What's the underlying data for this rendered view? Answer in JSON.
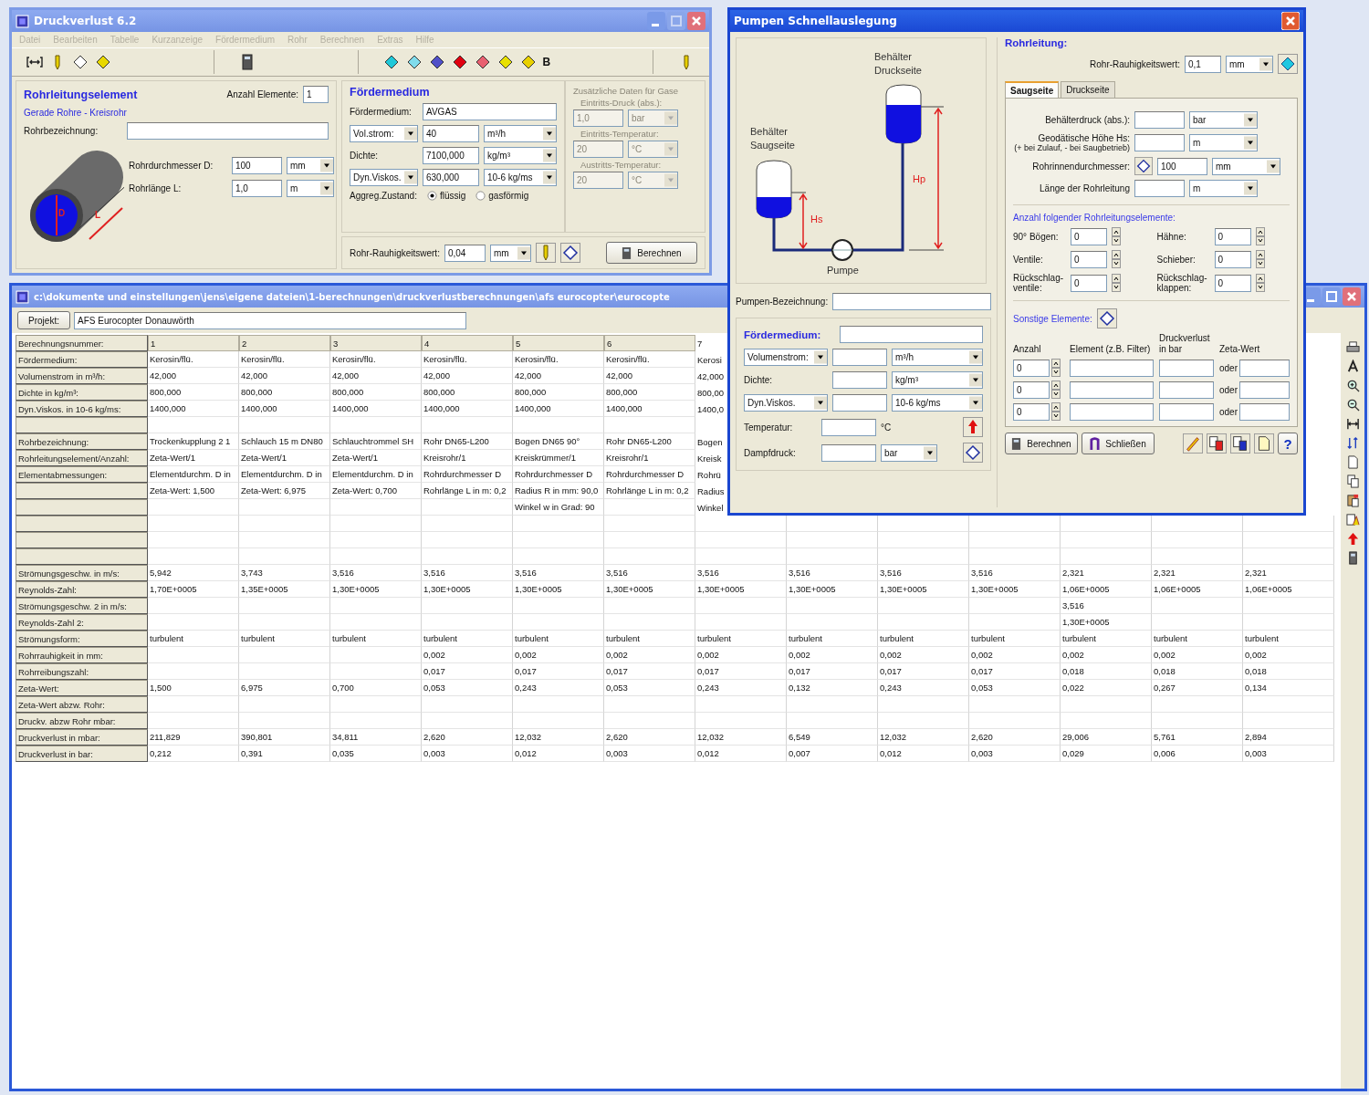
{
  "main_window": {
    "title": "Druckverlust 6.2",
    "menu": [
      {
        "label": "Datei",
        "disabled": true
      },
      {
        "label": "Bearbeiten",
        "disabled": true
      },
      {
        "label": "Tabelle",
        "disabled": true
      },
      {
        "label": "Kurzanzeige",
        "disabled": true
      },
      {
        "label": "Fördermedium",
        "disabled": true
      },
      {
        "label": "Rohr",
        "disabled": true
      },
      {
        "label": "Berechnen",
        "disabled": true
      },
      {
        "label": "Extras",
        "disabled": true
      },
      {
        "label": "Hilfe",
        "disabled": true
      }
    ],
    "toolbar": [
      {
        "kind": "bracket"
      },
      {
        "kind": "pencil"
      },
      {
        "kind": "diamond",
        "color": "#ffffff"
      },
      {
        "kind": "diamond",
        "color": "#e8d800"
      },
      {
        "kind": "separator"
      },
      {
        "kind": "calculator"
      },
      {
        "kind": "separator"
      },
      {
        "kind": "diamond",
        "color": "#20c8d8"
      },
      {
        "kind": "diamond",
        "color": "#80dcec"
      },
      {
        "kind": "diamond",
        "color": "#5050c8"
      },
      {
        "kind": "diamond",
        "color": "#e00010"
      },
      {
        "kind": "diamond",
        "color": "#e86070"
      },
      {
        "kind": "diamond",
        "color": "#e8e000"
      },
      {
        "kind": "diamond",
        "color": "#e8d000"
      },
      {
        "kind": "text",
        "label": "B"
      },
      {
        "kind": "separator"
      },
      {
        "kind": "pencil"
      }
    ],
    "pipe_element": {
      "heading": "Rohrleitungselement",
      "count_label": "Anzahl Elemente:",
      "count": "1",
      "type": "Gerade Rohre - Kreisrohr",
      "name_label": "Rohrbezeichnung:",
      "drawing_labels": [
        "D",
        "L"
      ],
      "fields": [
        {
          "label": "Rohrdurchmesser D:",
          "value": "100",
          "unit": "mm"
        },
        {
          "label": "Rohrlänge L:",
          "value": "1,0",
          "unit": "m"
        }
      ]
    },
    "medium": {
      "heading": "Fördermedium",
      "medium_label": "Fördermedium:",
      "medium": "AVGAS",
      "rows": [
        {
          "kind": "select",
          "label": "Vol.strom:",
          "value": "40",
          "unit": "m³/h"
        },
        {
          "kind": "label",
          "label": "Dichte:",
          "value": "7100,000",
          "unit": "kg/m³"
        },
        {
          "kind": "select",
          "label": "Dyn.Viskos.",
          "value": "630,000",
          "unit": "10-6 kg/ms"
        }
      ],
      "state_label": "Aggreg.Zustand:",
      "states": [
        {
          "label": "flüssig",
          "selected": true
        },
        {
          "label": "gasförmig",
          "selected": false
        }
      ]
    },
    "gas": {
      "heading": "Zusätzliche Daten für Gase",
      "disabled": true,
      "rows": [
        {
          "label": "Eintritts-Druck (abs.):",
          "value": "1,0",
          "unit": "bar"
        },
        {
          "label": "Eintritts-Temperatur:",
          "value": "20",
          "unit": "°C"
        },
        {
          "label": "Austritts-Temperatur:",
          "value": "20",
          "unit": "°C"
        }
      ]
    },
    "roughness": {
      "label": "Rohr-Rauhigkeitswert:",
      "value": "0,04",
      "unit": "mm"
    },
    "calculate_button": "Berechnen"
  },
  "table_window": {
    "title": "c:\\dokumente und einstellungen\\jens\\eigene dateien\\1-berechnungen\\druckverlustberechnungen\\afs eurocopter\\eurocopte",
    "project_button": "Projekt:",
    "project": "AFS Eurocopter Donauwörth",
    "rows": [
      {
        "kind": "header",
        "label": "Berechnungsnummer:",
        "cells": [
          "1",
          "2",
          "3",
          "4",
          "5",
          "6",
          "7"
        ]
      },
      {
        "kind": "data",
        "label": "Fördermedium:",
        "cells": [
          "Kerosin/flü.",
          "Kerosin/flü.",
          "Kerosin/flü.",
          "Kerosin/flü.",
          "Kerosin/flü.",
          "Kerosin/flü.",
          "Kerosi"
        ]
      },
      {
        "kind": "data",
        "label": "Volumenstrom in m³/h:",
        "cells": [
          "42,000",
          "42,000",
          "42,000",
          "42,000",
          "42,000",
          "42,000",
          "42,000"
        ]
      },
      {
        "kind": "data",
        "label": "Dichte in kg/m³:",
        "cells": [
          "800,000",
          "800,000",
          "800,000",
          "800,000",
          "800,000",
          "800,000",
          "800,00"
        ]
      },
      {
        "kind": "data",
        "label": "Dyn.Viskos. in 10-6 kg/ms:",
        "cells": [
          "1400,000",
          "1400,000",
          "1400,000",
          "1400,000",
          "1400,000",
          "1400,000",
          "1400,0"
        ]
      },
      {
        "kind": "data",
        "cells": []
      },
      {
        "kind": "data",
        "label": "Rohrbezeichnung:",
        "cells": [
          "Trockenkupplung 2 1",
          "Schlauch 15 m DN80",
          "Schlauchtrommel SH",
          "Rohr DN65-L200",
          "Bogen DN65 90°",
          "Rohr DN65-L200",
          "Bogen"
        ]
      },
      {
        "kind": "data",
        "label": "Rohrleitungselement/Anzahl:",
        "cells": [
          "Zeta-Wert/1",
          "Zeta-Wert/1",
          "Zeta-Wert/1",
          "Kreisrohr/1",
          "Kreiskrümmer/1",
          "Kreisrohr/1",
          "Kreisk"
        ]
      },
      {
        "kind": "data",
        "label": "Elementabmessungen:",
        "cells": [
          "Elementdurchm. D in",
          "Elementdurchm. D in",
          "Elementdurchm. D in",
          "Rohrdurchmesser D",
          "Rohrdurchmesser D",
          "Rohrdurchmesser D",
          "Rohrü"
        ]
      },
      {
        "kind": "data",
        "cells": [
          "Zeta-Wert: 1,500",
          "Zeta-Wert: 6,975",
          "Zeta-Wert: 0,700",
          "Rohrlänge L in m: 0,2",
          "Radius R in mm: 90,0",
          "Rohrlänge L in m: 0,2",
          "Radius"
        ]
      },
      {
        "kind": "data",
        "cells": [
          "",
          "",
          "",
          "",
          "Winkel w in Grad: 90",
          "",
          "Winkel"
        ]
      },
      {
        "kind": "data",
        "cells": []
      },
      {
        "kind": "data",
        "cells": []
      },
      {
        "kind": "data",
        "cells": []
      },
      {
        "kind": "data",
        "label": "Strömungsgeschw. in m/s:",
        "cells": [
          "5,942",
          "3,743",
          "3,516",
          "3,516",
          "3,516",
          "3,516",
          "3,516",
          "3,516",
          "3,516",
          "3,516",
          "2,321",
          "2,321",
          "2,321"
        ]
      },
      {
        "kind": "data",
        "label": "Reynolds-Zahl:",
        "cells": [
          "1,70E+0005",
          "1,35E+0005",
          "1,30E+0005",
          "1,30E+0005",
          "1,30E+0005",
          "1,30E+0005",
          "1,30E+0005",
          "1,30E+0005",
          "1,30E+0005",
          "1,30E+0005",
          "1,06E+0005",
          "1,06E+0005",
          "1,06E+0005"
        ]
      },
      {
        "kind": "data",
        "label": "Strömungsgeschw. 2 in m/s:",
        "cells": [
          "",
          "",
          "",
          "",
          "",
          "",
          "",
          "",
          "",
          "",
          "3,516"
        ]
      },
      {
        "kind": "data",
        "label": "Reynolds-Zahl 2:",
        "cells": [
          "",
          "",
          "",
          "",
          "",
          "",
          "",
          "",
          "",
          "",
          "1,30E+0005"
        ]
      },
      {
        "kind": "data",
        "label": "Strömungsform:",
        "cells": [
          "turbulent",
          "turbulent",
          "turbulent",
          "turbulent",
          "turbulent",
          "turbulent",
          "turbulent",
          "turbulent",
          "turbulent",
          "turbulent",
          "turbulent",
          "turbulent",
          "turbulent"
        ]
      },
      {
        "kind": "data",
        "label": "Rohrrauhigkeit in mm:",
        "cells": [
          "",
          "",
          "",
          "0,002",
          "0,002",
          "0,002",
          "0,002",
          "0,002",
          "0,002",
          "0,002",
          "0,002",
          "0,002",
          "0,002"
        ]
      },
      {
        "kind": "data",
        "label": "Rohrreibungszahl:",
        "cells": [
          "",
          "",
          "",
          "0,017",
          "0,017",
          "0,017",
          "0,017",
          "0,017",
          "0,017",
          "0,017",
          "0,018",
          "0,018",
          "0,018"
        ]
      },
      {
        "kind": "data",
        "label": "Zeta-Wert:",
        "cells": [
          "1,500",
          "6,975",
          "0,700",
          "0,053",
          "0,243",
          "0,053",
          "0,243",
          "0,132",
          "0,243",
          "0,053",
          "0,022",
          "0,267",
          "0,134"
        ]
      },
      {
        "kind": "data",
        "label": "Zeta-Wert abzw. Rohr:",
        "cells": []
      },
      {
        "kind": "data",
        "label": "Druckv. abzw Rohr mbar:",
        "cells": []
      },
      {
        "kind": "data",
        "label": "Druckverlust in mbar:",
        "cells": [
          "211,829",
          "390,801",
          "34,811",
          "2,620",
          "12,032",
          "2,620",
          "12,032",
          "6,549",
          "12,032",
          "2,620",
          "29,006",
          "5,761",
          "2,894"
        ]
      },
      {
        "kind": "data",
        "label": "Druckverlust in bar:",
        "cells": [
          "0,212",
          "0,391",
          "0,035",
          "0,003",
          "0,012",
          "0,003",
          "0,012",
          "0,007",
          "0,012",
          "0,003",
          "0,029",
          "0,006",
          "0,003"
        ]
      }
    ],
    "tools": [
      {
        "kind": "printer"
      },
      {
        "kind": "font"
      },
      {
        "kind": "zoom-in"
      },
      {
        "kind": "zoom-out"
      },
      {
        "kind": "column-width"
      },
      {
        "kind": "sort"
      },
      {
        "kind": "document"
      },
      {
        "kind": "copy"
      },
      {
        "kind": "paste"
      },
      {
        "kind": "export"
      },
      {
        "kind": "arrow-up"
      },
      {
        "kind": "calculator"
      }
    ]
  },
  "pump_window": {
    "title": "Pumpen Schnellauslegung",
    "diagram": {
      "suction_tank": "Behälter Saugseite",
      "pressure_tank": "Behälter Druckseite",
      "hs": "Hs",
      "hp": "Hp",
      "pump": "Pumpe"
    },
    "pump_name_label": "Pumpen-Bezeichnung:",
    "medium": {
      "heading": "Fördermedium:",
      "rows": [
        {
          "kind": "select",
          "label": "Volumenstrom:",
          "unit": "m³/h"
        },
        {
          "kind": "label",
          "label": "Dichte:",
          "unit": "kg/m³"
        },
        {
          "kind": "select",
          "label": "Dyn.Viskos.",
          "unit": "10-6 kg/ms"
        }
      ],
      "temperature_label": "Temperatur:",
      "temperature_unit": "°C",
      "vapor_label": "Dampfdruck:",
      "vapor_unit": "bar"
    },
    "pipe": {
      "heading": "Rohrleitung:",
      "roughness_label": "Rohr-Rauhigkeitswert:",
      "roughness": "0,1",
      "roughness_unit": "mm",
      "tabs": [
        {
          "label": "Saugseite",
          "selected": true
        },
        {
          "label": "Druckseite",
          "selected": false
        }
      ],
      "fields": [
        {
          "label": "Behälterdruck (abs.):",
          "unit": "bar"
        },
        {
          "label": "Geodätische Höhe Hs:",
          "note": "(+ bei Zulauf, - bei Saugbetrieb)",
          "unit": "m"
        },
        {
          "label": "Rohrinnendurchmesser:",
          "button": true,
          "value": "100",
          "unit": "mm"
        },
        {
          "label": "Länge der Rohrleitung",
          "unit": "m"
        }
      ],
      "elements_heading": "Anzahl folgender Rohrleitungselemente:",
      "elements": [
        {
          "label": "90° Bögen:",
          "value": "0"
        },
        {
          "label": "Hähne:",
          "value": "0"
        },
        {
          "label": "Ventile:",
          "value": "0"
        },
        {
          "label": "Schieber:",
          "value": "0"
        },
        {
          "label": "Rückschlag-ventile:",
          "value": "0"
        },
        {
          "label": "Rückschlag-klappen:",
          "value": "0"
        }
      ],
      "other_heading": "Sonstige Elemente:",
      "other_columns": [
        "Anzahl",
        "Element (z.B. Filter)",
        "Druckverlust in bar",
        "Zeta-Wert"
      ],
      "other_rows": [
        {
          "count": "0",
          "or": "oder"
        },
        {
          "count": "0",
          "or": "oder"
        },
        {
          "count": "0",
          "or": "oder"
        }
      ]
    },
    "buttons": [
      {
        "kind": "calculator",
        "label": "Berechnen"
      },
      {
        "kind": "exit",
        "label": "Schließen"
      }
    ],
    "tools": [
      {
        "kind": "pencil"
      },
      {
        "kind": "copy-red"
      },
      {
        "kind": "copy-blue"
      },
      {
        "kind": "document"
      },
      {
        "kind": "help",
        "label": "?"
      }
    ]
  }
}
